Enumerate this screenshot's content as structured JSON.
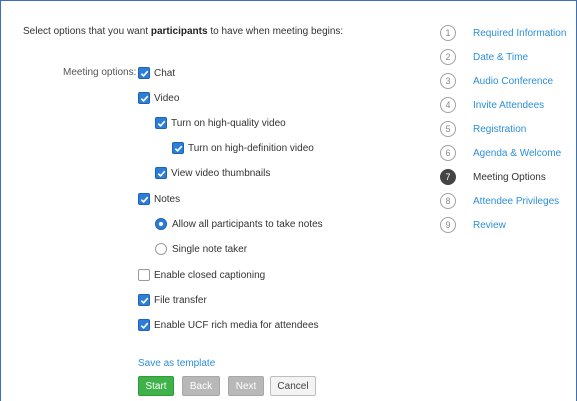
{
  "intro": {
    "before": "Select options that you want ",
    "bold": "participants",
    "after": " to have when meeting begins:"
  },
  "meeting_options_label": "Meeting options:",
  "options": [
    {
      "label": "Chat",
      "type": "checkbox",
      "checked": true
    },
    {
      "label": "Video",
      "type": "checkbox",
      "checked": true
    },
    {
      "label": "Turn on high-quality video",
      "type": "checkbox",
      "checked": true
    },
    {
      "label": "Turn on high-definition video",
      "type": "checkbox",
      "checked": true
    },
    {
      "label": "View video thumbnails",
      "type": "checkbox",
      "checked": true
    },
    {
      "label": "Notes",
      "type": "checkbox",
      "checked": true
    },
    {
      "label": "Allow all participants to take notes",
      "type": "radio",
      "checked": true
    },
    {
      "label": "Single note taker",
      "type": "radio",
      "checked": false
    },
    {
      "label": "Enable closed captioning",
      "type": "checkbox",
      "checked": false
    },
    {
      "label": "File transfer",
      "type": "checkbox",
      "checked": true
    },
    {
      "label": "Enable UCF rich media for attendees",
      "type": "checkbox",
      "checked": true
    }
  ],
  "save_template": "Save as template",
  "buttons": {
    "start": "Start",
    "back": "Back",
    "next": "Next",
    "cancel": "Cancel"
  },
  "steps": [
    {
      "num": "1",
      "label": "Required Information"
    },
    {
      "num": "2",
      "label": "Date & Time"
    },
    {
      "num": "3",
      "label": "Audio Conference"
    },
    {
      "num": "4",
      "label": "Invite Attendees"
    },
    {
      "num": "5",
      "label": "Registration"
    },
    {
      "num": "6",
      "label": "Agenda & Welcome"
    },
    {
      "num": "7",
      "label": "Meeting Options"
    },
    {
      "num": "8",
      "label": "Attendee Privileges"
    },
    {
      "num": "9",
      "label": "Review"
    }
  ],
  "current_step": 7,
  "colors": {
    "accent": "#2d7ed8",
    "link": "#2d8fd8",
    "start": "#3fb34a",
    "disabled": "#b8b8b8",
    "frame": "#3b6fb6"
  }
}
